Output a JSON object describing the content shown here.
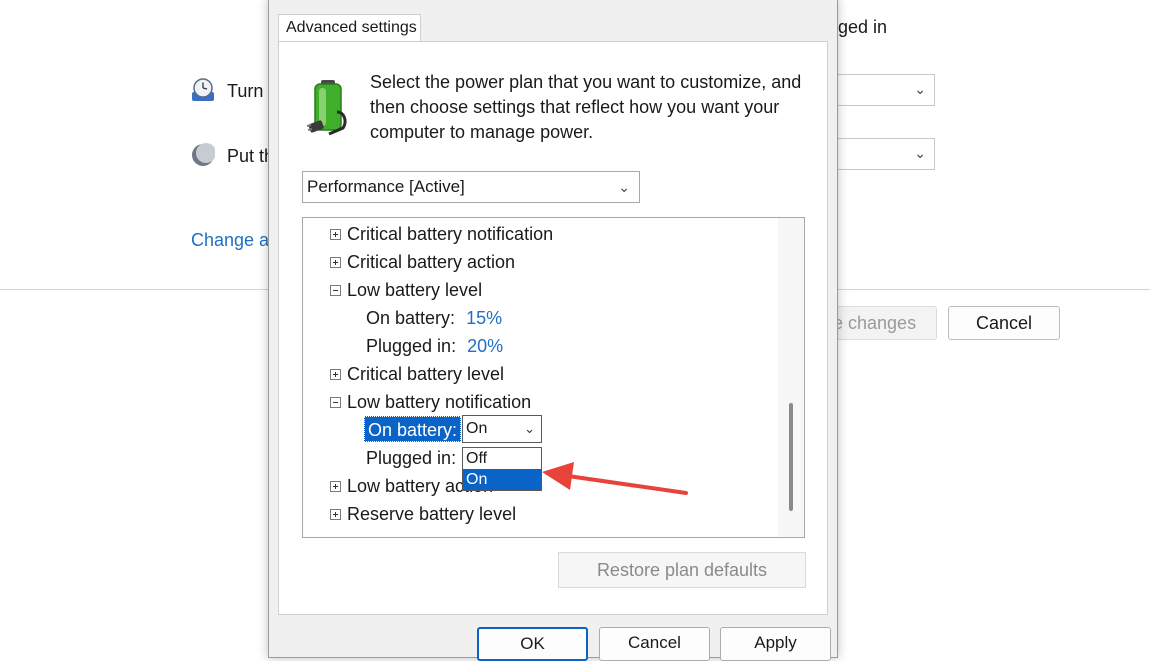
{
  "background": {
    "header_text": "ged in",
    "rows": [
      {
        "label": "Turn",
        "icon": "clock-icon"
      },
      {
        "label": "Put th",
        "icon": "moon-icon"
      }
    ],
    "link": "Change ac",
    "save_button": "e changes",
    "cancel_button": "Cancel"
  },
  "dialog": {
    "tab": "Advanced settings",
    "description": "Select the power plan that you want to customize, and then choose settings that reflect how you want your computer to manage power.",
    "plan_select": "Performance [Active]",
    "tree": {
      "items": [
        {
          "label": "Critical battery notification",
          "state": "collapsed"
        },
        {
          "label": "Critical battery action",
          "state": "collapsed"
        },
        {
          "label": "Low battery level",
          "state": "expanded"
        },
        {
          "sub": "On battery:",
          "value": "15%"
        },
        {
          "sub": "Plugged in:",
          "value": "20%"
        },
        {
          "label": "Critical battery level",
          "state": "collapsed"
        },
        {
          "label": "Low battery notification",
          "state": "expanded"
        },
        {
          "sub": "On battery:",
          "value": "On"
        },
        {
          "sub": "Plugged in:",
          "value": ""
        },
        {
          "label": "Low battery action",
          "state": "collapsed"
        },
        {
          "label": "Reserve battery level",
          "state": "collapsed"
        }
      ],
      "dropdown_options": [
        "Off",
        "On"
      ],
      "dropdown_highlighted": "On"
    },
    "restore_button": "Restore plan defaults",
    "buttons": {
      "ok": "OK",
      "cancel": "Cancel",
      "apply": "Apply"
    }
  },
  "colors": {
    "accent": "#0a64c8",
    "link": "#1f6fc5",
    "annotation_arrow": "#e8433a"
  }
}
